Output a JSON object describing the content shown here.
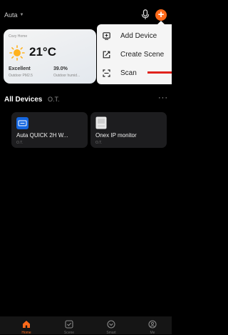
{
  "header": {
    "home_name": "Auta"
  },
  "weather": {
    "home_label": "Cozy Home",
    "temperature": "21°C",
    "air_quality": "Excellent",
    "air_quality_label": "Outdoor PM2.5",
    "humidity": "39.0%",
    "humidity_label": "Outdoor humid..."
  },
  "menu": {
    "items": [
      {
        "label": "Add Device",
        "icon": "add-device-icon"
      },
      {
        "label": "Create Scene",
        "icon": "create-scene-icon"
      },
      {
        "label": "Scan",
        "icon": "scan-icon"
      }
    ]
  },
  "tabs": [
    {
      "label": "All Devices"
    },
    {
      "label": "O.T."
    }
  ],
  "devices": [
    {
      "name": "Auta QUICK 2H W...",
      "room": "O.T."
    },
    {
      "name": "Onex IP monitor",
      "room": "O.T."
    }
  ],
  "nav": [
    {
      "label": "Home",
      "icon": "home-icon"
    },
    {
      "label": "Scene",
      "icon": "scene-icon"
    },
    {
      "label": "Smart",
      "icon": "smart-icon"
    },
    {
      "label": "Me",
      "icon": "me-icon"
    }
  ],
  "colors": {
    "accent": "#ff6a1a",
    "annotation": "#e0231d",
    "device_blue": "#1567e0"
  }
}
